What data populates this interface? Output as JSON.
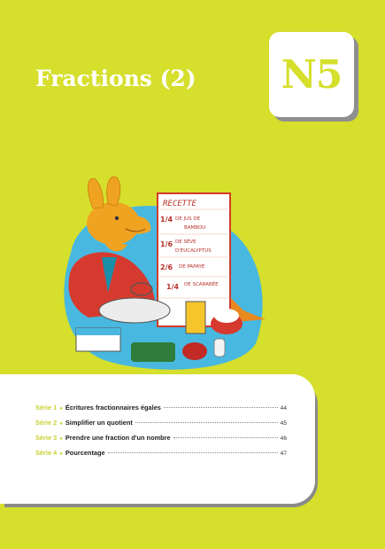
{
  "chapter": {
    "title": "Fractions (2)",
    "code": "N5"
  },
  "illustration": {
    "board_title": "RECETTE",
    "lines": [
      {
        "fraction": "1/4",
        "text": "DE JUS DE",
        "text2": "BAMBOU"
      },
      {
        "fraction": "1/6",
        "text": "DE SÈVE",
        "text2": "D'EUCALYPTUS"
      },
      {
        "fraction": "2/6",
        "text": "DE PAPAYE",
        "text2": ""
      },
      {
        "fraction": "1/4",
        "text": "DE SCARABÉE",
        "text2": ""
      }
    ]
  },
  "toc": [
    {
      "series": "Série 1",
      "topic": "Écritures fractionnaires égales",
      "page": "44"
    },
    {
      "series": "Série 2",
      "topic": "Simplifier un quotient",
      "page": "45"
    },
    {
      "series": "Série 3",
      "topic": "Prendre une fraction d'un nombre",
      "page": "46"
    },
    {
      "series": "Série 4",
      "topic": "Pourcentage",
      "page": "47"
    }
  ],
  "colors": {
    "background": "#d5df2c",
    "accent": "#c9d132",
    "card": "#ffffff"
  }
}
